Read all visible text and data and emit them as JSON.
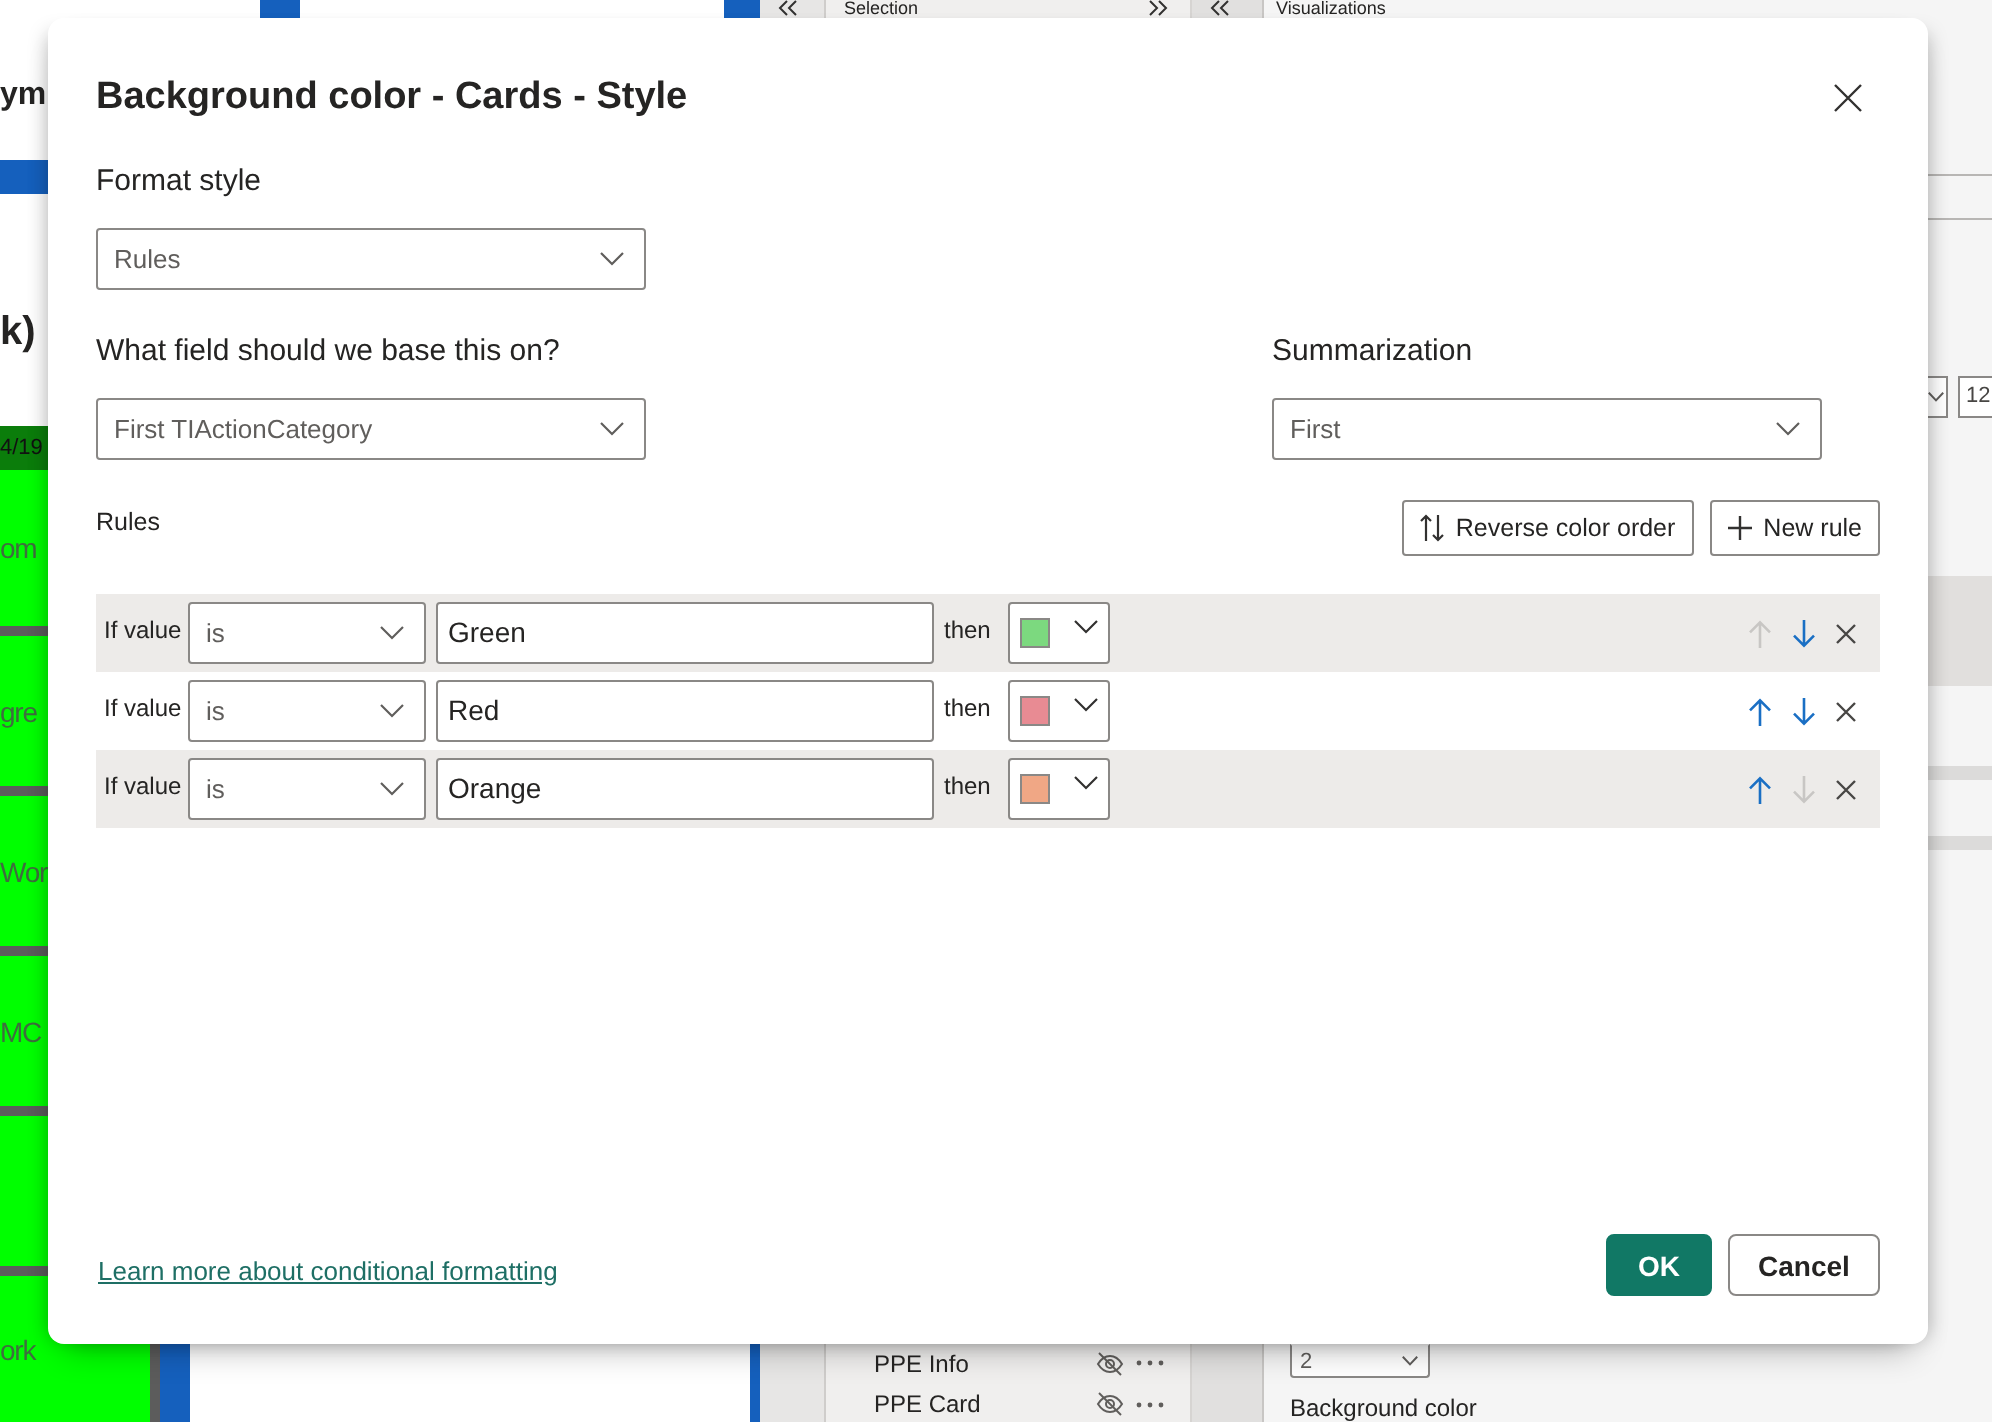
{
  "report_canvas": {
    "title_fragment": "ym",
    "subtitle_fragment": "k)",
    "date_fragment": "4/19",
    "cards": [
      {
        "kind": "label",
        "text": "om"
      },
      {
        "kind": "label",
        "text": "gre"
      },
      {
        "kind": "label",
        "text": "Wor"
      },
      {
        "kind": "label",
        "text": "MC"
      },
      {
        "kind": "blank"
      },
      {
        "kind": "label",
        "text": "ork"
      }
    ]
  },
  "selection_pane": {
    "title": "Selection",
    "items": [
      {
        "label": "PPE Info",
        "hidden": true
      },
      {
        "label": "PPE Card",
        "hidden": true
      }
    ]
  },
  "visualizations_pane": {
    "title": "Visualizations",
    "size_value": "12",
    "dropdown_value": "2",
    "section_label": "Background color"
  },
  "dialog": {
    "title": "Background color - Cards - Style",
    "format_style": {
      "label": "Format style",
      "value": "Rules"
    },
    "field": {
      "label": "What field should we base this on?",
      "value": "First TIActionCategory"
    },
    "summarization": {
      "label": "Summarization",
      "value": "First"
    },
    "rules": {
      "label": "Rules",
      "actions": [
        {
          "kind": "reverse",
          "label": "Reverse color order"
        },
        {
          "kind": "add",
          "label": "New rule"
        }
      ],
      "rows": [
        {
          "prefix": "If value",
          "operator": "is",
          "value": "Green",
          "suffix": "then",
          "color": "#7cd97f",
          "up_disabled": true,
          "down_disabled": false
        },
        {
          "prefix": "If value",
          "operator": "is",
          "value": "Red",
          "suffix": "then",
          "color": "#e88b93",
          "up_disabled": false,
          "down_disabled": false
        },
        {
          "prefix": "If value",
          "operator": "is",
          "value": "Orange",
          "suffix": "then",
          "color": "#f0a785",
          "up_disabled": false,
          "down_disabled": true
        }
      ]
    },
    "link": "Learn more about conditional formatting",
    "buttons": [
      {
        "kind": "primary",
        "label": "OK"
      },
      {
        "kind": "secondary",
        "label": "Cancel"
      }
    ]
  }
}
